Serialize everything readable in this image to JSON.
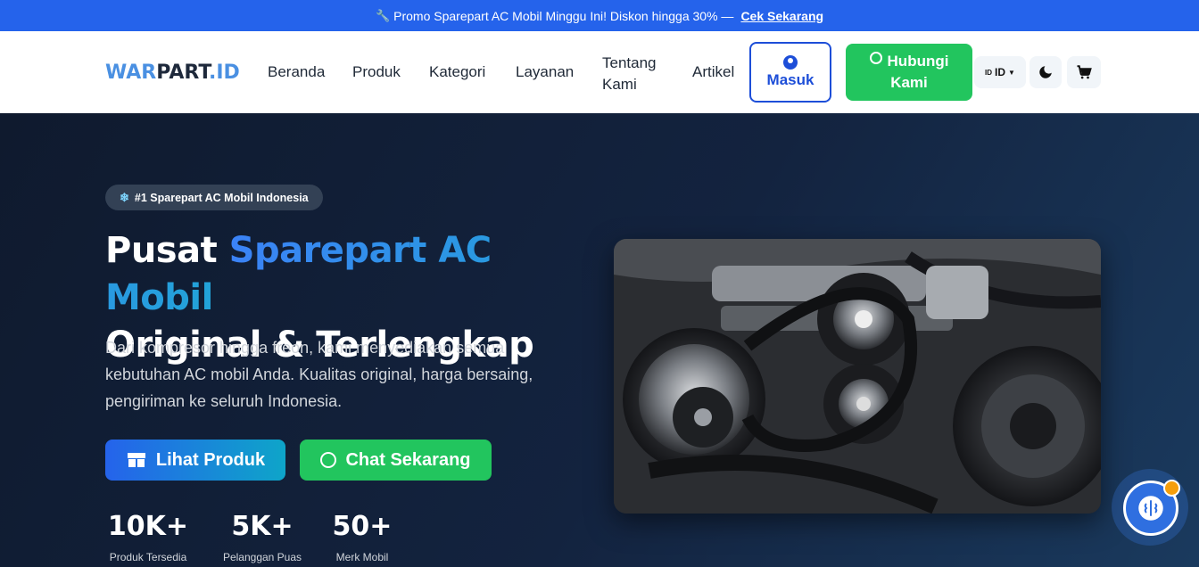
{
  "promo": {
    "text": "Promo Sparepart AC Mobil Minggu Ini! Diskon hingga 30% —",
    "link": "Cek Sekarang"
  },
  "nav": {
    "logo": {
      "part1": "WAR",
      "part2": "PART",
      "part3": ".ID"
    },
    "links": [
      "Beranda",
      "Produk",
      "Kategori",
      "Layanan",
      "Tentang Kami",
      "Artikel"
    ],
    "login": "Masuk",
    "contact": "Hubungi Kami",
    "lang": "ID",
    "lang_flag": "ID",
    "icons": {
      "theme": "moon-icon",
      "cart": "cart-icon"
    }
  },
  "hero": {
    "badge": "#1 Sparepart AC Mobil Indonesia",
    "title_pre": "Pusat ",
    "title_accent": "Sparepart AC Mobil",
    "title_line2": "Original & Terlengkap",
    "description": "Dari kompresor hingga freon, kami menyediakan semua kebutuhan AC mobil Anda. Kualitas original, harga bersaing, pengiriman ke seluruh Indonesia.",
    "btn_products": "Lihat Produk",
    "btn_chat": "Chat Sekarang",
    "stats": [
      {
        "number": "10K+",
        "label": "Produk Tersedia"
      },
      {
        "number": "5K+",
        "label": "Pelanggan Puas"
      },
      {
        "number": "50+",
        "label": "Merk Mobil"
      }
    ]
  },
  "colors": {
    "promo_bg": "#2563eb",
    "accent": "#2563eb",
    "whatsapp": "#22c55e",
    "hero_bg": "#0f1a2e"
  }
}
